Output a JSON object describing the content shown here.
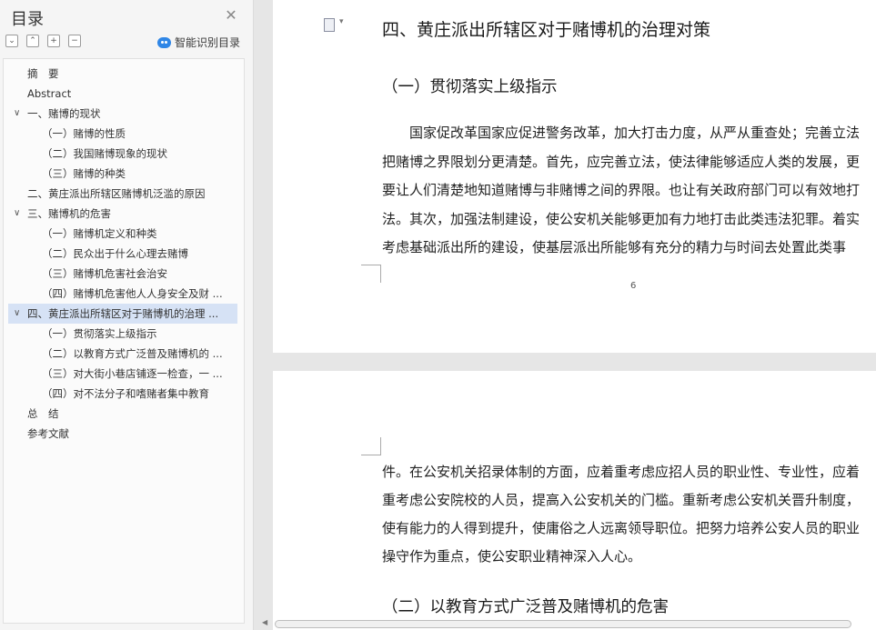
{
  "toc": {
    "title": "目录",
    "close_icon": "close-icon",
    "tools": [
      "collapse-all-icon",
      "expand-all-icon",
      "add-level-icon",
      "remove-level-icon"
    ],
    "smart_label": "智能识别目录",
    "items": [
      {
        "label": "摘　要"
      },
      {
        "label": "Abstract"
      },
      {
        "label": "一、赌博的现状",
        "expanded": true
      },
      {
        "label": "（一）赌博的性质"
      },
      {
        "label": "（二）我国赌博现象的现状"
      },
      {
        "label": "（三）赌博的种类"
      },
      {
        "label": "二、黄庄派出所辖区赌博机泛滥的原因"
      },
      {
        "label": "三、赌博机的危害",
        "expanded": true
      },
      {
        "label": "（一）赌博机定义和种类"
      },
      {
        "label": "（二）民众出于什么心理去赌博"
      },
      {
        "label": "（三）赌博机危害社会治安"
      },
      {
        "label": "（四）赌博机危害他人人身安全及财 ..."
      },
      {
        "label": "四、黄庄派出所辖区对于赌博机的治理 ...",
        "expanded": true,
        "active": true
      },
      {
        "label": "（一）贯彻落实上级指示"
      },
      {
        "label": "（二）以教育方式广泛普及赌博机的 ..."
      },
      {
        "label": "（三）对大街小巷店铺逐一检查，一 ..."
      },
      {
        "label": "（四）对不法分子和嗜赌者集中教育"
      },
      {
        "label": "总　结"
      },
      {
        "label": "参考文献"
      }
    ]
  },
  "doc": {
    "heading": "四、黄庄派出所辖区对于赌博机的治理对策",
    "subheading1": "（一）贯彻落实上级指示",
    "para1": [
      "国家促改革国家应促进警务改革，加大打击力度，从严从重查处；完善立法",
      "把赌博之界限划分更清楚。首先，应完善立法，使法律能够适应人类的发展，更",
      "要让人们清楚地知道赌博与非赌博之间的界限。也让有关政府部门可以有效地打",
      "法。其次，加强法制建设，使公安机关能够更加有力地打击此类违法犯罪。着实",
      "考虑基础派出所的建设，使基层派出所能够有充分的精力与时间去处置此类事"
    ],
    "page_number": "6",
    "para2": [
      "件。在公安机关招录体制的方面，应着重考虑应招人员的职业性、专业性，应着",
      "重考虑公安院校的人员，提高入公安机关的门槛。重新考虑公安机关晋升制度，",
      "使有能力的人得到提升，使庸俗之人远离领导职位。把努力培养公安人员的职业",
      "操守作为重点，使公安职业精神深入人心。"
    ],
    "subheading2": "（二）以教育方式广泛普及赌博机的危害"
  }
}
